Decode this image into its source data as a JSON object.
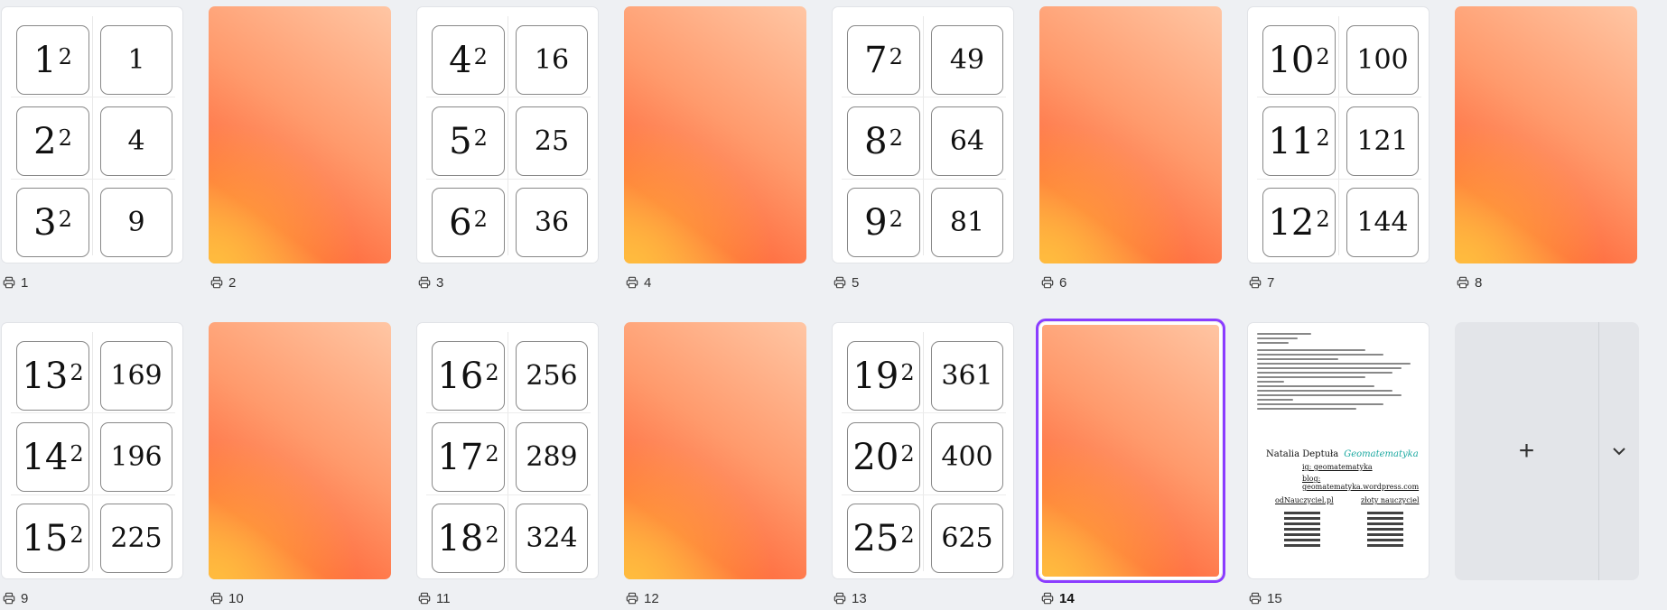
{
  "pages": [
    {
      "number": "1",
      "type": "cards",
      "rows": [
        {
          "base": "1",
          "exp": "2",
          "value": "1"
        },
        {
          "base": "2",
          "exp": "2",
          "value": "4"
        },
        {
          "base": "3",
          "exp": "2",
          "value": "9"
        }
      ]
    },
    {
      "number": "2",
      "type": "gradient"
    },
    {
      "number": "3",
      "type": "cards",
      "rows": [
        {
          "base": "4",
          "exp": "2",
          "value": "16"
        },
        {
          "base": "5",
          "exp": "2",
          "value": "25"
        },
        {
          "base": "6",
          "exp": "2",
          "value": "36"
        }
      ]
    },
    {
      "number": "4",
      "type": "gradient"
    },
    {
      "number": "5",
      "type": "cards",
      "rows": [
        {
          "base": "7",
          "exp": "2",
          "value": "49"
        },
        {
          "base": "8",
          "exp": "2",
          "value": "64"
        },
        {
          "base": "9",
          "exp": "2",
          "value": "81"
        }
      ]
    },
    {
      "number": "6",
      "type": "gradient"
    },
    {
      "number": "7",
      "type": "cards",
      "rows": [
        {
          "base": "10",
          "exp": "2",
          "value": "100"
        },
        {
          "base": "11",
          "exp": "2",
          "value": "121"
        },
        {
          "base": "12",
          "exp": "2",
          "value": "144"
        }
      ]
    },
    {
      "number": "8",
      "type": "gradient"
    },
    {
      "number": "9",
      "type": "cards",
      "rows": [
        {
          "base": "13",
          "exp": "2",
          "value": "169"
        },
        {
          "base": "14",
          "exp": "2",
          "value": "196"
        },
        {
          "base": "15",
          "exp": "2",
          "value": "225"
        }
      ]
    },
    {
      "number": "10",
      "type": "gradient"
    },
    {
      "number": "11",
      "type": "cards",
      "rows": [
        {
          "base": "16",
          "exp": "2",
          "value": "256"
        },
        {
          "base": "17",
          "exp": "2",
          "value": "289"
        },
        {
          "base": "18",
          "exp": "2",
          "value": "324"
        }
      ]
    },
    {
      "number": "12",
      "type": "gradient"
    },
    {
      "number": "13",
      "type": "cards",
      "rows": [
        {
          "base": "19",
          "exp": "2",
          "value": "361"
        },
        {
          "base": "20",
          "exp": "2",
          "value": "400"
        },
        {
          "base": "25",
          "exp": "2",
          "value": "625"
        }
      ]
    },
    {
      "number": "14",
      "type": "gradient",
      "selected": true
    },
    {
      "number": "15",
      "type": "info"
    }
  ],
  "page15": {
    "author": "Natalia Deptuła",
    "brand": "Geomatematyka",
    "ig": "ig: geomatematyka",
    "blog": "blog: geomatematyka.wordpress.com",
    "qr_left": "odNauczyciel.pl",
    "qr_right": "złoty nauczyciel"
  },
  "add_page": {
    "plus_icon": "plus-icon",
    "menu_icon": "chevron-down-icon"
  },
  "colors": {
    "selected_outline": "#8b3dff",
    "gradient_start": "#ffc6a4",
    "gradient_end": "#ff6b3d"
  }
}
